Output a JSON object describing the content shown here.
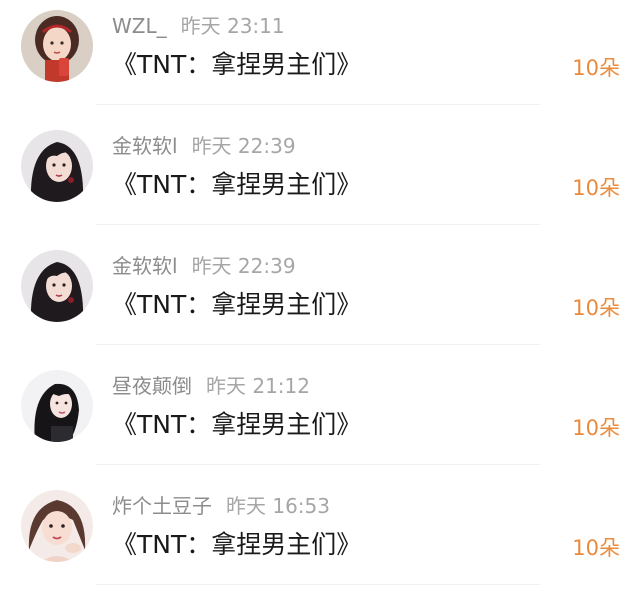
{
  "comments": [
    {
      "username": "WZL_",
      "time": "昨天 23:11",
      "book": "《TNT：拿捏男主们》",
      "gift": "10朵",
      "avatar": "user-avatar-wzl"
    },
    {
      "username": "金软软l",
      "time": "昨天 22:39",
      "book": "《TNT：拿捏男主们》",
      "gift": "10朵",
      "avatar": "user-avatar-jinruanruan"
    },
    {
      "username": "金软软l",
      "time": "昨天 22:39",
      "book": "《TNT：拿捏男主们》",
      "gift": "10朵",
      "avatar": "user-avatar-jinruanruan"
    },
    {
      "username": "昼夜颠倒",
      "time": "昨天 21:12",
      "book": "《TNT：拿捏男主们》",
      "gift": "10朵",
      "avatar": "user-avatar-zhouyediandao"
    },
    {
      "username": "炸个土豆子",
      "time": "昨天 16:53",
      "book": "《TNT：拿捏男主们》",
      "gift": "10朵",
      "avatar": "user-avatar-zhagetudouzi"
    }
  ],
  "colors": {
    "username": "#8c8c8c",
    "time": "#a6a6a6",
    "book": "#1a1a1a",
    "gift": "#e98a3c",
    "divider": "#f0f0f0"
  }
}
